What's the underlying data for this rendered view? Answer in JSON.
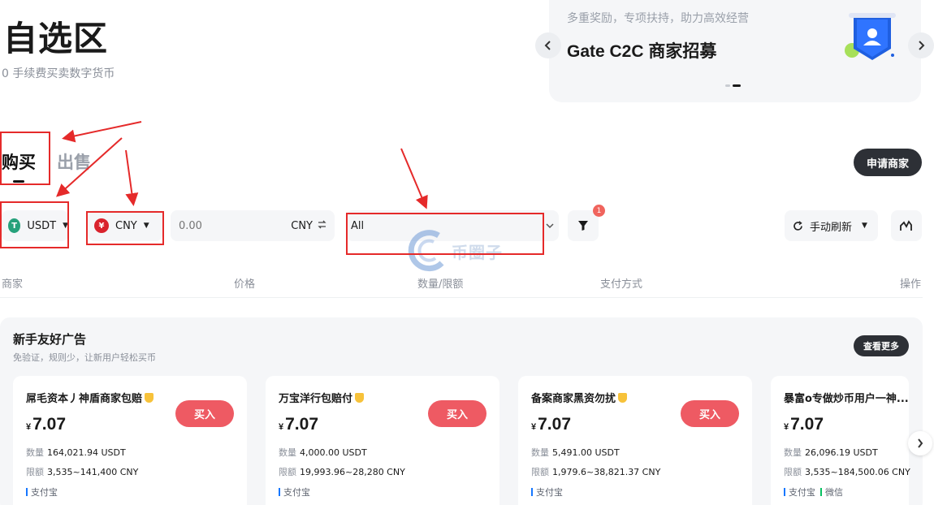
{
  "page": {
    "title": "自选区",
    "subtitle": "0 手续费买卖数字货币"
  },
  "banner": {
    "subtitle": "多重奖励，专项扶持，助力高效经营",
    "title": "Gate C2C 商家招募",
    "prev_icon": "chevron-left-icon",
    "next_icon": "chevron-right-icon",
    "illustration_icon": "merchant-badge-icon"
  },
  "tabs": {
    "buy": "购买",
    "sell": "出售",
    "active": "buy"
  },
  "apply_merchant": "申请商家",
  "filters": {
    "coin": "USDT",
    "fiat": "CNY",
    "amount_placeholder": "0.00",
    "amount_unit": "CNY",
    "payment": "All",
    "filter_badge": "1",
    "refresh": "手动刷新"
  },
  "table_headers": {
    "merchant": "商家",
    "price": "价格",
    "quantity_limit": "数量/限额",
    "payment": "支付方式",
    "action": "操作"
  },
  "newbie": {
    "title": "新手友好广告",
    "subtitle": "免验证，规则少，让新用户轻松买币",
    "more": "查看更多",
    "cards": [
      {
        "name": "屌毛资本丿神盾商家包赔",
        "currency": "¥",
        "price": "7.07",
        "buy": "买入",
        "qty_label": "数量",
        "qty": "164,021.94 USDT",
        "limit_label": "限额",
        "limit": "3,535~141,400 CNY",
        "payments": [
          "支付宝"
        ]
      },
      {
        "name": "万宝洋行包赔付",
        "currency": "¥",
        "price": "7.07",
        "buy": "买入",
        "qty_label": "数量",
        "qty": "4,000.00 USDT",
        "limit_label": "限额",
        "limit": "19,993.96~28,280 CNY",
        "payments": [
          "支付宝"
        ]
      },
      {
        "name": "备案商家黑资勿扰",
        "currency": "¥",
        "price": "7.07",
        "buy": "买入",
        "qty_label": "数量",
        "qty": "5,491.00 USDT",
        "limit_label": "限额",
        "limit": "1,979.6~38,821.37 CNY",
        "payments": [
          "支付宝"
        ]
      },
      {
        "name": "暴富o专做炒币用户一神...",
        "currency": "¥",
        "price": "7.07",
        "buy": "买入",
        "qty_label": "数量",
        "qty": "26,096.19 USDT",
        "limit_label": "限额",
        "limit": "3,535~184,500.06 CNY",
        "payments": [
          "支付宝",
          "微信"
        ]
      }
    ]
  },
  "watermark": "币圈子",
  "colors": {
    "accent_buy": "#ee5a63",
    "dark_button": "#2d3036",
    "annotation": "#e52a2a",
    "usdt": "#26a17b",
    "cny": "#d9232d",
    "alipay": "#1677ff",
    "wechat": "#07c160"
  }
}
